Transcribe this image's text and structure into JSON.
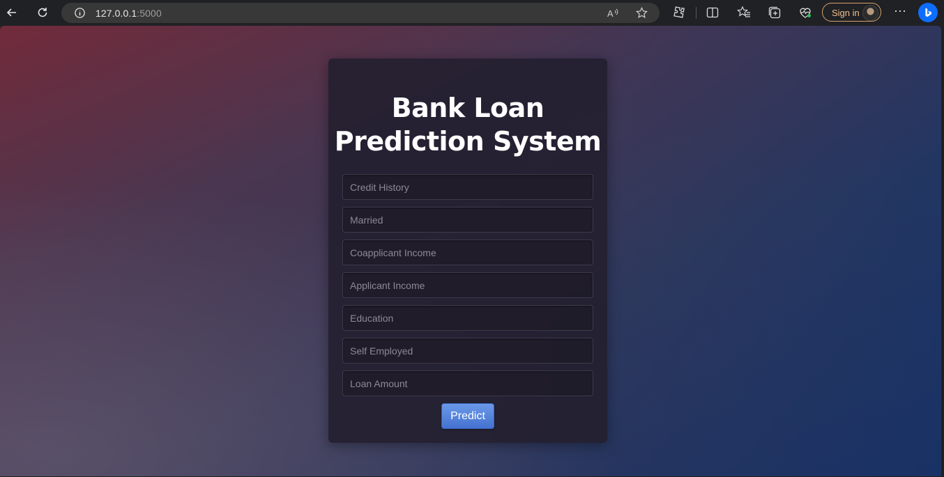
{
  "browser": {
    "url_host": "127.0.0.1",
    "url_port": ":5000",
    "signin_label": "Sign in",
    "more_label": "⋯"
  },
  "page": {
    "title_line1": "Bank Loan",
    "title_line2": "Prediction System",
    "fields": [
      {
        "placeholder": "Credit History"
      },
      {
        "placeholder": "Married"
      },
      {
        "placeholder": "Coapplicant Income"
      },
      {
        "placeholder": "Applicant Income"
      },
      {
        "placeholder": "Education"
      },
      {
        "placeholder": "Self Employed"
      },
      {
        "placeholder": "Loan Amount"
      }
    ],
    "predict_label": "Predict"
  },
  "colors": {
    "accent_button": "#4572d0",
    "signin_border": "#d7a46c"
  }
}
